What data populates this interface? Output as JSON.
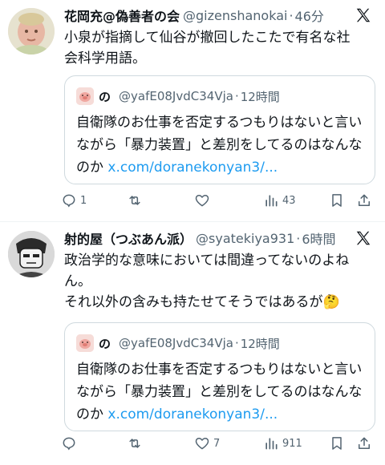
{
  "posts": [
    {
      "author_name": "花岡充@偽善者の会",
      "handle": "@gizenshanokai",
      "time": "46分",
      "text_lines": [
        "小泉が指摘して仙谷が撤回したこたで有名な社",
        "会科学用語。"
      ],
      "quote": {
        "name": "の",
        "handle": "@yafE08JvdC34Vja",
        "time": "12時間",
        "text": "自衛隊のお仕事を否定するつもりはないと言いながら「暴力装置」と差別をしてるのはなんなのか ",
        "link": "x.com/doranekonyan3/..."
      },
      "actions": {
        "reply": "1",
        "repost": "",
        "like": "",
        "views": "43"
      },
      "avatar_icon": "baby-portrait-avatar"
    },
    {
      "author_name": "射的屋（つぶあん派）",
      "handle": "@syatekiya931",
      "time": "6時間",
      "text_lines": [
        "政治学的な意味においては間違ってないのよね",
        "ん。",
        "それ以外の含みも持たせてそうではあるが🤔"
      ],
      "quote": {
        "name": "の",
        "handle": "@yafE08JvdC34Vja",
        "time": "12時間",
        "text": "自衛隊のお仕事を否定するつもりはないと言いながら「暴力装置」と差別をしてるのはなんなのか ",
        "link": "x.com/doranekonyan3/..."
      },
      "actions": {
        "reply": "",
        "repost": "",
        "like": "7",
        "views": "911"
      },
      "avatar_icon": "manga-character-avatar"
    }
  ],
  "colors": {
    "text": "#0f1419",
    "muted": "#536471",
    "link": "#1d9bf0",
    "border": "#cfd9de"
  }
}
